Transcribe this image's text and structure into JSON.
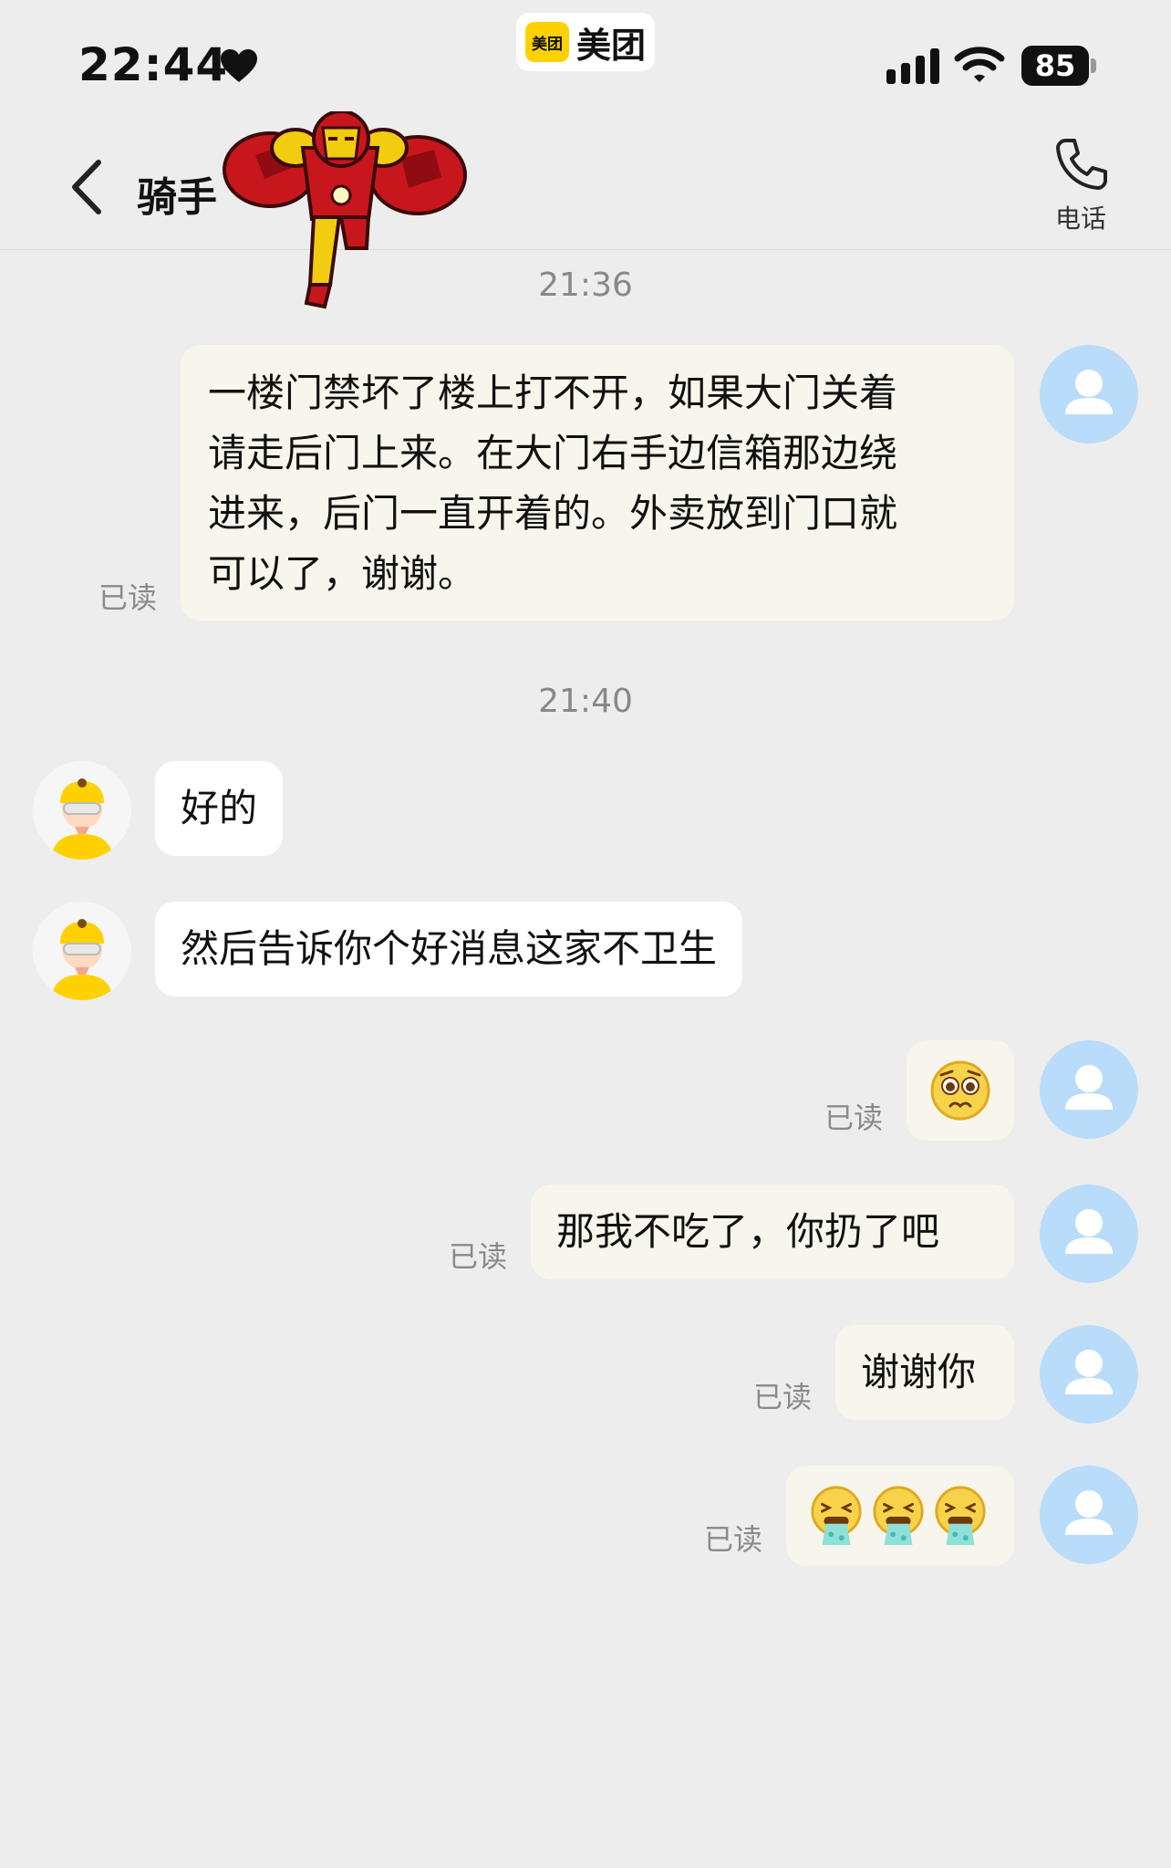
{
  "status_bar": {
    "time": "22:44",
    "app_badge": "美团",
    "app_name": "美团",
    "battery": "85"
  },
  "header": {
    "title": "骑手",
    "call_label": "电话"
  },
  "read_label": "已读",
  "timestamps": [
    "21:36",
    "21:40"
  ],
  "messages": [
    {
      "sender": "me",
      "lines": [
        "一楼门禁坏了楼上打不开，如果大门关着",
        "请走后门上来。在大门右手边信箱那边绕",
        "进来，后门一直开着的。外卖放到门口就",
        "可以了，谢谢。"
      ],
      "status": "已读"
    },
    {
      "sender": "rider",
      "text": "好的"
    },
    {
      "sender": "rider",
      "text": "然后告诉你个好消息这家不卫生"
    },
    {
      "sender": "me",
      "emoji": "pleading-face",
      "status": "已读"
    },
    {
      "sender": "me",
      "text": "那我不吃了，你扔了吧",
      "status": "已读"
    },
    {
      "sender": "me",
      "text": "谢谢你",
      "status": "已读"
    },
    {
      "sender": "me",
      "emoji": "vomiting-face x3",
      "status": "已读"
    }
  ],
  "colors": {
    "background": "#ededed",
    "my_bubble": "#f8f6ec",
    "rider_bubble": "#ffffff",
    "my_avatar": "#b9dcfa",
    "brand_yellow": "#ffd100"
  }
}
